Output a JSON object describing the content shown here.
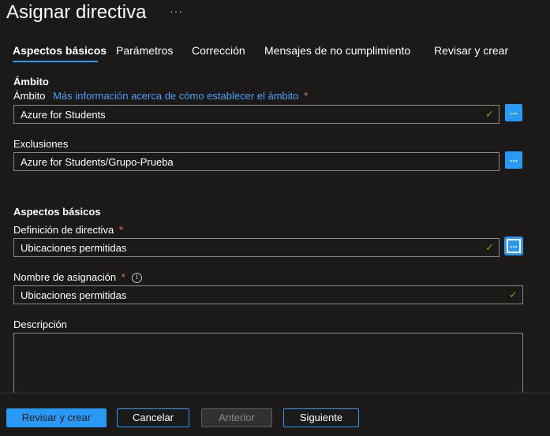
{
  "header": {
    "title": "Asignar directiva",
    "more_icon": "···"
  },
  "tabs": [
    {
      "label": "Aspectos básicos",
      "active": true
    },
    {
      "label": "Parámetros"
    },
    {
      "label": "Corrección"
    },
    {
      "label": "Mensajes de no cumplimiento"
    },
    {
      "label": "Revisar y crear"
    }
  ],
  "scope": {
    "section_title": "Ámbito",
    "label": "Ámbito",
    "learn_more": "Más información acerca de cómo establecer el ámbito",
    "required": "*",
    "value": "Azure for Students",
    "check": "✓",
    "picker": "..."
  },
  "exclusions": {
    "label": "Exclusiones",
    "value": "Azure for Students/Grupo-Prueba",
    "picker": "..."
  },
  "basics": {
    "section_title": "Aspectos básicos",
    "definition_label": "Definición de directiva",
    "definition_value": "Ubicaciones permitidas",
    "definition_picker": "...",
    "assignment_label": "Nombre de asignación",
    "assignment_value": "Ubicaciones permitidas",
    "info": "i",
    "description_label": "Descripción",
    "required": "*",
    "check": "✓"
  },
  "footer": {
    "review_create": "Revisar y crear",
    "cancel": "Cancelar",
    "previous": "Anterior",
    "next": "Siguiente"
  },
  "colors": {
    "accent": "#2899f5",
    "required": "#f1707b",
    "valid": "#6bb700",
    "background": "#1b1a19"
  },
  "icons": {
    "more": "more-icon",
    "check": "check-icon",
    "info": "info-icon",
    "picker": "ellipsis-icon"
  }
}
